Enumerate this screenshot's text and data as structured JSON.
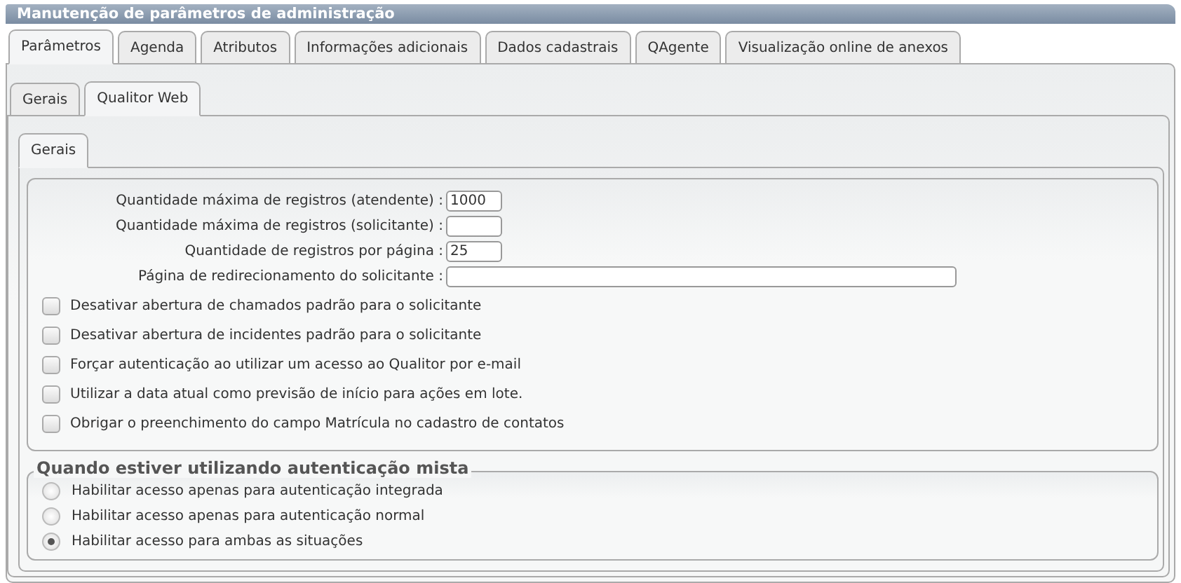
{
  "window": {
    "title": "Manutenção de parâmetros de administração"
  },
  "tabs": [
    {
      "label": "Parâmetros",
      "selected": true
    },
    {
      "label": "Agenda",
      "selected": false
    },
    {
      "label": "Atributos",
      "selected": false
    },
    {
      "label": "Informações adicionais",
      "selected": false
    },
    {
      "label": "Dados cadastrais",
      "selected": false
    },
    {
      "label": "QAgente",
      "selected": false
    },
    {
      "label": "Visualização online de anexos",
      "selected": false
    }
  ],
  "subtabs": [
    {
      "label": "Gerais",
      "selected": false
    },
    {
      "label": "Qualitor Web",
      "selected": true
    }
  ],
  "section_tabs": [
    {
      "label": "Gerais",
      "selected": true
    }
  ],
  "fields": [
    {
      "label": "Quantidade máxima de registros (atendente) :",
      "value": "1000",
      "kind": "short"
    },
    {
      "label": "Quantidade máxima de registros (solicitante) :",
      "kind": "short"
    },
    {
      "label": "Quantidade de registros por página :",
      "value": "25",
      "kind": "short"
    },
    {
      "label": "Página de redirecionamento do solicitante :",
      "kind": "long"
    }
  ],
  "checkboxes": [
    {
      "label": "Desativar abertura de chamados padrão para o solicitante",
      "checked": false
    },
    {
      "label": "Desativar abertura de incidentes padrão para o solicitante",
      "checked": false
    },
    {
      "label": "Forçar autenticação ao utilizar um acesso ao Qualitor por e-mail",
      "checked": false
    },
    {
      "label": "Utilizar a data atual como previsão de início para ações em lote.",
      "checked": false
    },
    {
      "label": "Obrigar o preenchimento do campo Matrícula no cadastro de contatos",
      "checked": false
    }
  ],
  "mixed_auth": {
    "legend": "Quando estiver utilizando autenticação mista",
    "options": [
      {
        "label": "Habilitar acesso apenas para autenticação integrada",
        "selected": false
      },
      {
        "label": "Habilitar acesso apenas para autenticação normal",
        "selected": false
      },
      {
        "label": "Habilitar acesso para ambas as situações",
        "selected": true
      }
    ]
  }
}
